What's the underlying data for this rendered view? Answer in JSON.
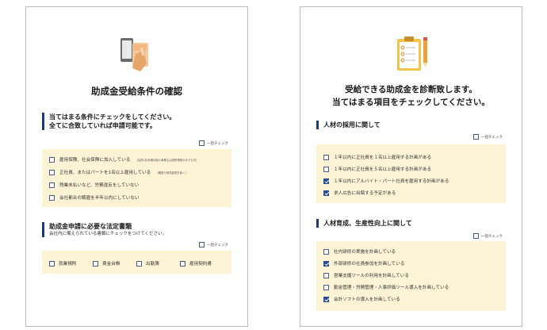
{
  "left": {
    "title": "助成金受給条件の確認",
    "intro_line1": "当てはまる条件にチェックをしてください。",
    "intro_line2": "全てに合致していれば申請可能です。",
    "check_all": "一括チェック",
    "conditions": [
      {
        "label": "雇用保険、社会保険に加入している",
        "note": "（会員5名未満の個人事業主は週所得税のみでも可）",
        "checked": false
      },
      {
        "label": "正社員、またはパートを1名以上雇用している",
        "note": "（親族や役員経営を除く）",
        "checked": false
      },
      {
        "label": "残業未払いなど、労務違反をしていない",
        "note": "",
        "checked": false
      },
      {
        "label": "会社都合の解雇を半年以内にしていない",
        "note": "",
        "checked": false
      }
    ],
    "docs_title": "助成金申請に必要な法定書類",
    "docs_subtitle": "会社内に備えられている書類にチェックをつけてください。",
    "docs_check_all": "一括チェック",
    "documents": [
      "就業規則",
      "賃金台帳",
      "出勤簿",
      "雇用契約書"
    ]
  },
  "right": {
    "title_line1": "受給できる助成金を診断致します。",
    "title_line2": "当てはまる項目をチェックしてください。",
    "hiring_title": "人材の採用に関して",
    "hiring_check_all": "一括チェック",
    "hiring_items": [
      {
        "label": "１年以内に正社員を１名以上雇用する計画がある",
        "checked": false
      },
      {
        "label": "１年以内に正社員を５名以上雇用する計画がある",
        "checked": false
      },
      {
        "label": "１年以内にアルバイト・パート社員を雇用する計画がある",
        "checked": true
      },
      {
        "label": "求人広告に出稿する予定がある",
        "checked": true
      }
    ],
    "dev_title": "人材育成、生産性向上に関して",
    "dev_check_all": "一括チェック",
    "dev_items": [
      {
        "label": "社内研修の実施を計画している",
        "checked": false
      },
      {
        "label": "外部研修の社員参加を計画している",
        "checked": true
      },
      {
        "label": "営業支援ツールの利用を計画している",
        "checked": false
      },
      {
        "label": "勤怠管理・労務管理・人事評価ツール導入を計画している",
        "checked": false
      },
      {
        "label": "会計ソフトの導入を計画している",
        "checked": true
      }
    ]
  },
  "colors": {
    "accent": "#1f3a7a",
    "checked": "#2a4f9a",
    "panel": "#fdf4d6",
    "icon_yellow": "#f3c34a"
  }
}
